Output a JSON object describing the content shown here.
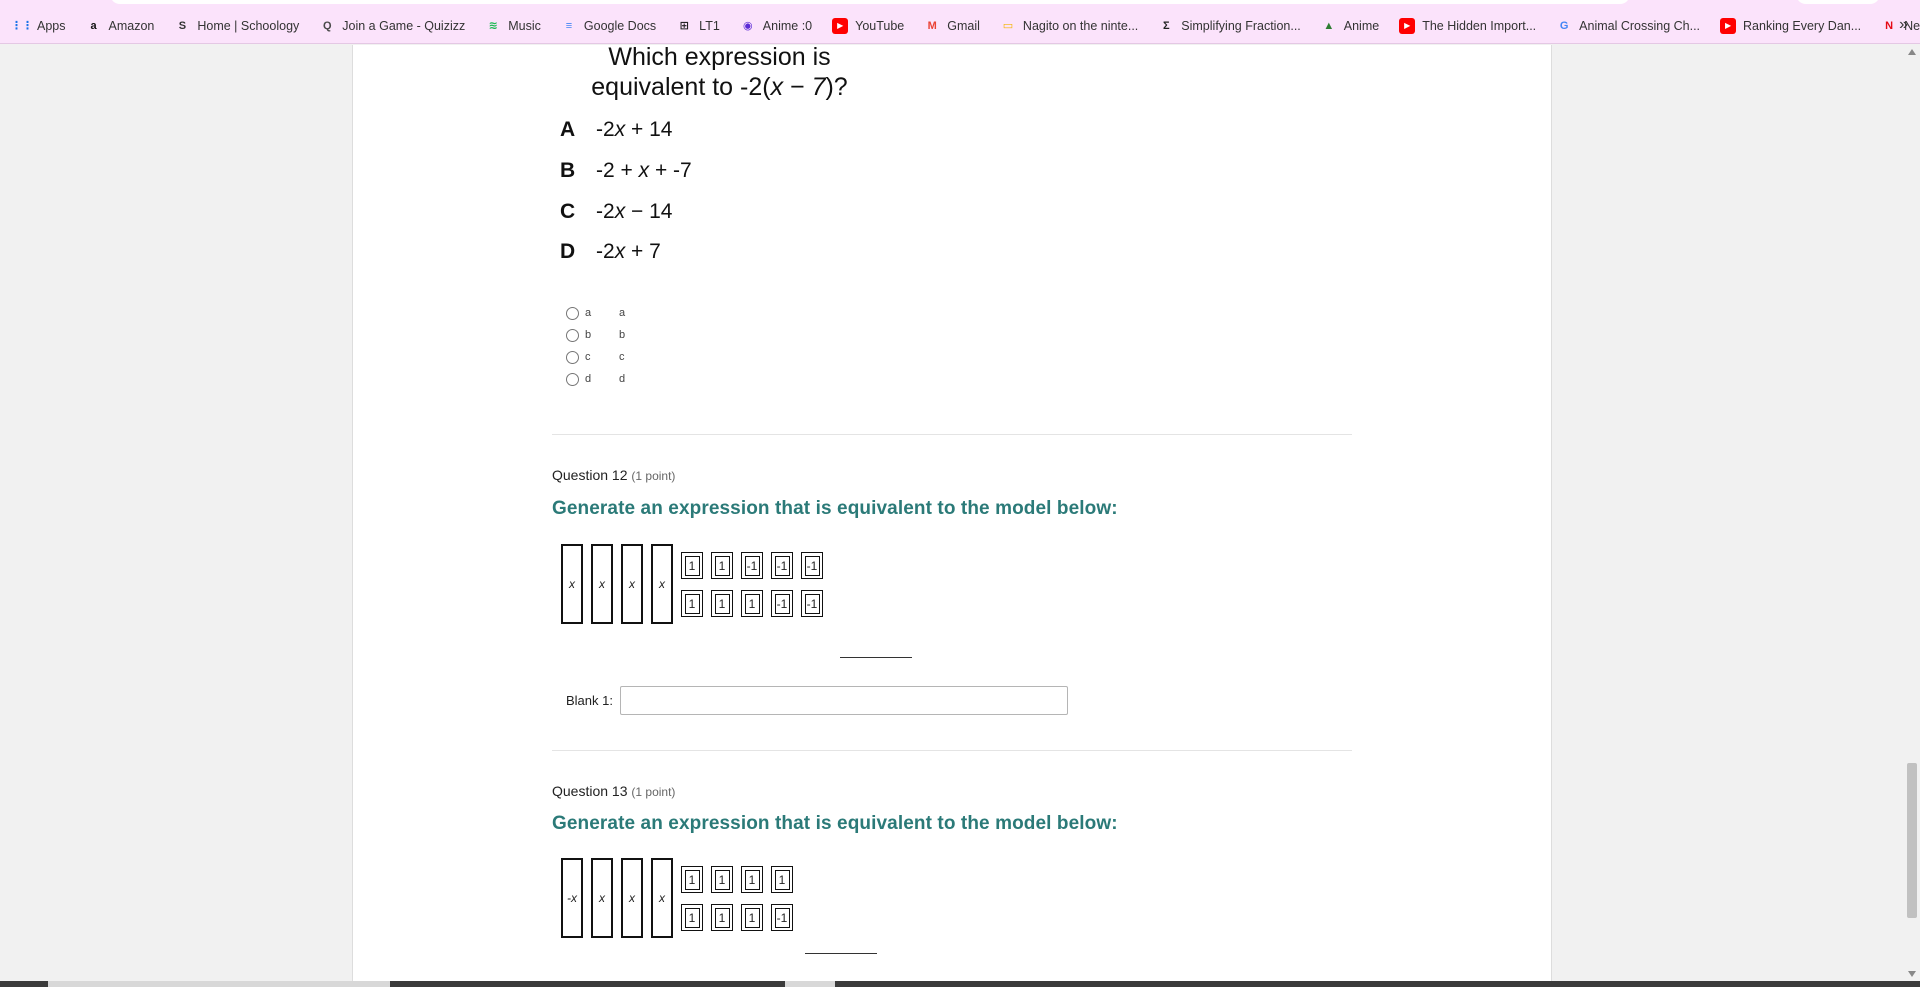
{
  "browser": {
    "bookmarks": [
      {
        "label": "Apps",
        "icon": "apps-grid-icon",
        "color": "#1a73e8"
      },
      {
        "label": "Amazon",
        "icon": "amazon-icon",
        "color": "#111111"
      },
      {
        "label": "Home | Schoology",
        "icon": "schoology-icon",
        "color": "#333333"
      },
      {
        "label": "Join a Game - Quizizz",
        "icon": "quizizz-icon",
        "color": "#4a4a4a"
      },
      {
        "label": "Music",
        "icon": "spotify-icon",
        "color": "#1db954"
      },
      {
        "label": "Google Docs",
        "icon": "google-docs-icon",
        "color": "#4285f4"
      },
      {
        "label": "LT1",
        "icon": "lt1-icon",
        "color": "#222222"
      },
      {
        "label": "Anime :0",
        "icon": "anime-icon",
        "color": "#5b2bd6"
      },
      {
        "label": "YouTube",
        "icon": "youtube-icon",
        "color": "#ff0000"
      },
      {
        "label": "Gmail",
        "icon": "gmail-icon",
        "color": "#ea4335"
      },
      {
        "label": "Nagito on the ninte...",
        "icon": "slides-icon",
        "color": "#f4b400"
      },
      {
        "label": "Simplifying Fraction...",
        "icon": "sigma-icon",
        "color": "#222222"
      },
      {
        "label": "Anime",
        "icon": "mountain-icon",
        "color": "#2e7d32"
      },
      {
        "label": "The Hidden Import...",
        "icon": "youtube-icon",
        "color": "#ff0000"
      },
      {
        "label": "Animal Crossing Ch...",
        "icon": "google-icon",
        "color": "#4285f4"
      },
      {
        "label": "Ranking Every Dan...",
        "icon": "youtube-icon",
        "color": "#ff0000"
      },
      {
        "label": "Netflix",
        "icon": "netflix-icon",
        "color": "#e50914"
      }
    ],
    "more_glyph": "»"
  },
  "q11": {
    "title_line1": "Which expression is",
    "title_line2_prefix": "equivalent to -2(",
    "title_line2_var": "x",
    "title_line2_mid": " − ",
    "title_line2_num": "7",
    "title_line2_suffix": ")?",
    "options": [
      {
        "letter": "A",
        "pre": "-2",
        "var": "x",
        "post": " + 14"
      },
      {
        "letter": "B",
        "pre": "-2 + ",
        "var": "x",
        "post": " + -7"
      },
      {
        "letter": "C",
        "pre": "-2",
        "var": "x",
        "post": " − 14"
      },
      {
        "letter": "D",
        "pre": "-2",
        "var": "x",
        "post": " + 7"
      }
    ],
    "answers": [
      {
        "value": "a",
        "label": "a"
      },
      {
        "value": "b",
        "label": "b"
      },
      {
        "value": "c",
        "label": "c"
      },
      {
        "value": "d",
        "label": "d"
      }
    ]
  },
  "q12": {
    "header": "Question 12",
    "points": "(1 point)",
    "prompt": "Generate an expression that is equivalent to the model below:",
    "x_tiles": [
      "x",
      "x",
      "x",
      "x"
    ],
    "unit_top": [
      "1",
      "1",
      "-1",
      "-1",
      "-1"
    ],
    "unit_bottom": [
      "1",
      "1",
      "1",
      "-1",
      "-1"
    ],
    "blank_label": "Blank 1:",
    "blank_value": ""
  },
  "q13": {
    "header": "Question 13",
    "points": "(1 point)",
    "prompt": "Generate an expression that is equivalent to the model below:",
    "x_tiles": [
      "-x",
      "x",
      "x",
      "x"
    ],
    "unit_top": [
      "1",
      "1",
      "1",
      "1"
    ],
    "unit_bottom": [
      "1",
      "1",
      "1",
      "-1"
    ]
  }
}
